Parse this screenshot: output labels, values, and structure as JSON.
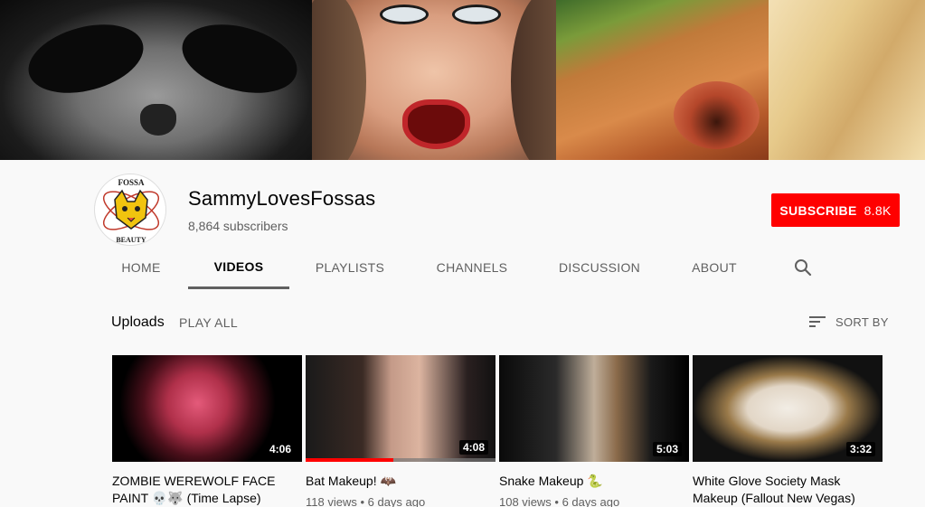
{
  "channel": {
    "name": "SammyLovesFossas",
    "subscribers": "8,864 subscribers",
    "avatar_text_top": "FOSSA",
    "avatar_text_bottom": "BEAUTY"
  },
  "subscribe": {
    "label": "SUBSCRIBE",
    "count": "8.8K"
  },
  "tabs": [
    {
      "label": "HOME",
      "active": false
    },
    {
      "label": "VIDEOS",
      "active": true
    },
    {
      "label": "PLAYLISTS",
      "active": false
    },
    {
      "label": "CHANNELS",
      "active": false
    },
    {
      "label": "DISCUSSION",
      "active": false
    },
    {
      "label": "ABOUT",
      "active": false
    }
  ],
  "section": {
    "title": "Uploads",
    "play_all": "PLAY ALL",
    "sort_by": "SORT BY"
  },
  "videos": [
    {
      "title": "ZOMBIE WEREWOLF FACE PAINT 💀🐺 (Time Lapse)",
      "duration": "4:06",
      "meta": "",
      "progress": 0
    },
    {
      "title": "Bat Makeup! 🦇",
      "duration": "4:08",
      "meta": "118 views • 6 days ago",
      "progress": 0.46
    },
    {
      "title": "Snake Makeup 🐍",
      "duration": "5:03",
      "meta": "108 views • 6 days ago",
      "progress": 0
    },
    {
      "title": "White Glove Society Mask Makeup (Fallout New Vegas)",
      "duration": "3:32",
      "meta": "",
      "progress": 0
    }
  ],
  "colors": {
    "brand_red": "#ff0000",
    "text_primary": "#030303",
    "text_secondary": "#606060",
    "background": "#f9f9f9"
  }
}
